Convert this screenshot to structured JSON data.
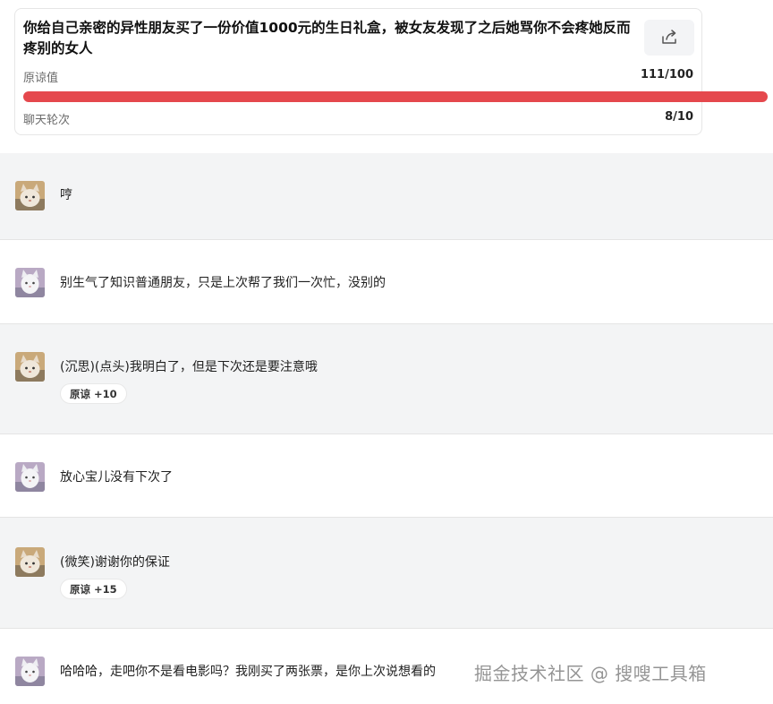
{
  "header": {
    "title": "你给自己亲密的异性朋友买了一份价值1000元的生日礼盒，被女友发现了之后她骂你不会疼她反而疼别的女人",
    "share_icon": "share-icon",
    "forgiveness": {
      "label": "原谅值",
      "value": "111/100",
      "fraction": 1.0
    },
    "rounds": {
      "label": "聊天轮次",
      "value": "8/10"
    },
    "bar_color": "#e5484d"
  },
  "messages": [
    {
      "role": "ai",
      "avatar": "cat-avatar-orange",
      "text": "哼"
    },
    {
      "role": "user",
      "avatar": "cat-avatar-white",
      "text": "别生气了知识普通朋友，只是上次帮了我们一次忙，没别的"
    },
    {
      "role": "ai",
      "avatar": "cat-avatar-orange",
      "text": "(沉思)(点头)我明白了，但是下次还是要注意哦",
      "badge": {
        "label": "原谅",
        "delta": "+10"
      }
    },
    {
      "role": "user",
      "avatar": "cat-avatar-white",
      "text": "放心宝儿没有下次了"
    },
    {
      "role": "ai",
      "avatar": "cat-avatar-orange",
      "text": "(微笑)谢谢你的保证",
      "badge": {
        "label": "原谅",
        "delta": "+15"
      }
    },
    {
      "role": "user",
      "avatar": "cat-avatar-white",
      "text": "哈哈哈，走吧你不是看电影吗？我刚买了两张票，是你上次说想看的"
    }
  ],
  "watermark": "掘金技术社区 @ 搜嗖工具箱"
}
